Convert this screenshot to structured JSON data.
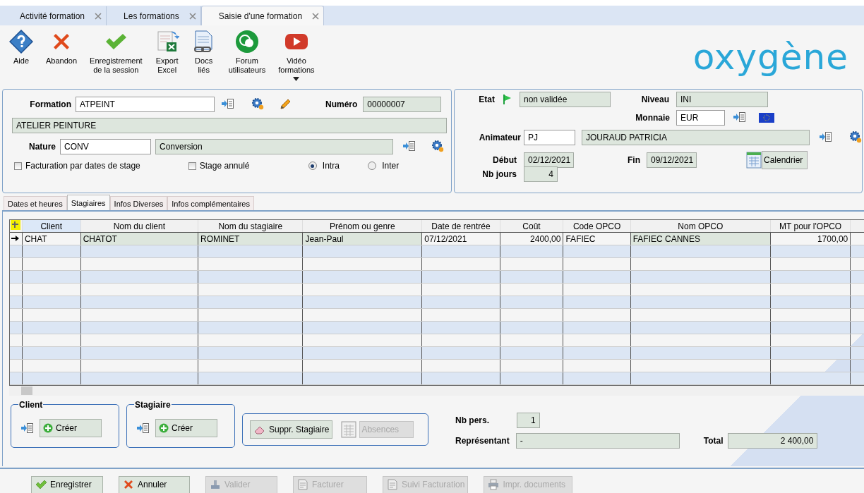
{
  "tabs": [
    {
      "label": "Activité formation",
      "selected": false
    },
    {
      "label": "Les formations",
      "selected": false
    },
    {
      "label": "Saisie d'une formation",
      "selected": true
    }
  ],
  "toolbar": [
    {
      "kind": "help",
      "lines": [
        "Aide"
      ],
      "dropdown": false
    },
    {
      "kind": "abandon",
      "lines": [
        "Abandon"
      ],
      "dropdown": false
    },
    {
      "kind": "save",
      "lines": [
        "Enregistrement",
        "de la session"
      ],
      "dropdown": false
    },
    {
      "kind": "export",
      "lines": [
        "Export",
        "Excel"
      ],
      "dropdown": false
    },
    {
      "kind": "docs",
      "lines": [
        "Docs",
        "liés"
      ],
      "dropdown": false
    },
    {
      "kind": "forum",
      "lines": [
        "Forum",
        "utilisateurs"
      ],
      "dropdown": false
    },
    {
      "kind": "video",
      "lines": [
        "Vidéo",
        "formations"
      ],
      "dropdown": true
    }
  ],
  "logo": "oxygène",
  "formation": {
    "label": "Formation",
    "code": "ATPEINT",
    "numero_label": "Numéro",
    "numero": "00000007",
    "title": "ATELIER PEINTURE",
    "nature_label": "Nature",
    "nature_code": "CONV",
    "nature": "Conversion",
    "options": [
      {
        "label": "Facturation par dates de stage",
        "checked": false
      },
      {
        "label": "Stage annulé",
        "checked": false
      }
    ],
    "scope": [
      {
        "label": "Intra",
        "selected": true
      },
      {
        "label": "Inter",
        "selected": false
      }
    ]
  },
  "session": {
    "etat_label": "Etat",
    "etat": "non validée",
    "niveau_label": "Niveau",
    "niveau": "INI",
    "monnaie_label": "Monnaie",
    "monnaie": "EUR",
    "animateur_label": "Animateur",
    "animateur_code": "PJ",
    "animateur": "JOURAUD PATRICIA",
    "debut_label": "Début",
    "debut": "02/12/2021",
    "fin_label": "Fin",
    "fin": "09/12/2021",
    "calendar_button": "Calendrier",
    "nb_jours_label": "Nb jours",
    "nb_jours": "4"
  },
  "subtabs": [
    {
      "label": "Dates et heures",
      "selected": false
    },
    {
      "label": "Stagiaires",
      "selected": true
    },
    {
      "label": "Infos Diverses",
      "selected": false
    },
    {
      "label": "Infos complémentaires",
      "selected": false
    }
  ],
  "table": {
    "columns": [
      {
        "label": "Client",
        "kind": "text",
        "selected": true
      },
      {
        "label": "Nom du client",
        "kind": "readonly",
        "selected": false
      },
      {
        "label": "Nom du stagiaire",
        "kind": "readonly",
        "selected": false
      },
      {
        "label": "Prénom ou genre",
        "kind": "readonly",
        "selected": false
      },
      {
        "label": "Date de rentrée",
        "kind": "text",
        "selected": false
      },
      {
        "label": "Coût",
        "kind": "amount",
        "selected": false
      },
      {
        "label": "Code OPCO",
        "kind": "text",
        "selected": false
      },
      {
        "label": "Nom OPCO",
        "kind": "readonly",
        "selected": false
      },
      {
        "label": "MT pour l'OPCO",
        "kind": "amount",
        "selected": false
      }
    ],
    "rows": [
      {
        "current": true,
        "cells": [
          "CHAT",
          "CHATOT",
          "ROMINET",
          "Jean-Paul",
          "07/12/2021",
          "2400,00",
          "FAFIEC",
          "FAFIEC CANNES",
          "1700,00"
        ]
      }
    ]
  },
  "groups": [
    {
      "title": "Client",
      "button": "Créer"
    },
    {
      "title": "Stagiaire",
      "button": "Créer"
    }
  ],
  "actions": [
    {
      "label": "Suppr. Stagiaire",
      "kind": "eraser",
      "disabled": false
    },
    {
      "label": "Absences",
      "kind": "calendar",
      "disabled": true
    }
  ],
  "summary": {
    "nb_pers_label": "Nb pers.",
    "nb_pers": "1",
    "representant_label": "Représentant",
    "representant": "-",
    "total_label": "Total",
    "total": "2 400,00"
  },
  "footer": [
    {
      "label": "Enregistrer",
      "kind": "check",
      "disabled": false
    },
    {
      "label": "Annuler",
      "kind": "cross",
      "disabled": false
    },
    {
      "label": "Valider",
      "kind": "stamp",
      "disabled": true
    },
    {
      "label": "Facturer",
      "kind": "invoice",
      "disabled": true
    },
    {
      "label": "Suivi Facturation",
      "kind": "invoice",
      "disabled": true
    },
    {
      "label": "Impr. documents",
      "kind": "printer",
      "disabled": true
    }
  ]
}
